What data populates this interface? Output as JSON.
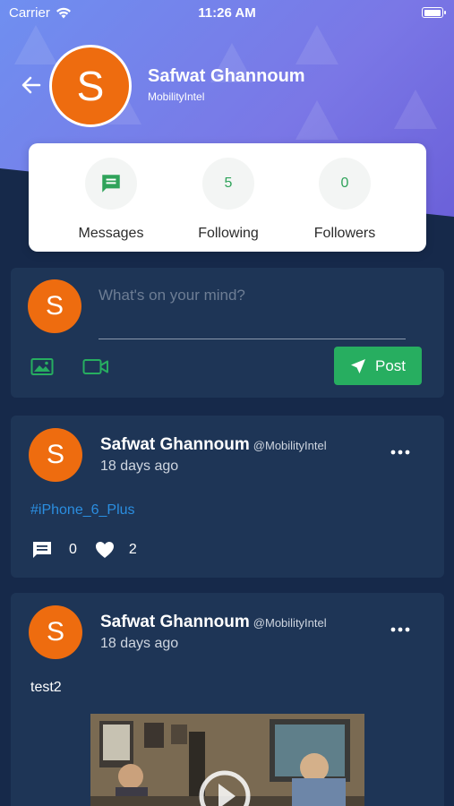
{
  "status_bar": {
    "carrier": "Carrier",
    "time": "11:26 AM"
  },
  "profile": {
    "avatar_letter": "S",
    "name": "Safwat Ghannoum",
    "handle": "MobilityIntel"
  },
  "stats": [
    {
      "label": "Messages",
      "value": "",
      "icon": "message-icon"
    },
    {
      "label": "Following",
      "value": "5"
    },
    {
      "label": "Followers",
      "value": "0"
    }
  ],
  "composer": {
    "avatar_letter": "S",
    "placeholder": "What's on your mind?",
    "post_label": "Post"
  },
  "posts": [
    {
      "avatar_letter": "S",
      "author": "Safwat Ghannoum",
      "handle": "@MobilityIntel",
      "time": "18 days ago",
      "body": "#iPhone_6_Plus",
      "comments": "0",
      "likes": "2"
    },
    {
      "avatar_letter": "S",
      "author": "Safwat Ghannoum",
      "handle": "@MobilityIntel",
      "time": "18 days ago",
      "body": "test2"
    }
  ],
  "colors": {
    "header_gradient_start": "#6f8ff0",
    "header_gradient_end": "#6a5fd8",
    "background": "#16294a",
    "card": "#1e3556",
    "avatar": "#ee6c0f",
    "accent_green": "#27ae60",
    "hashtag_blue": "#2b8ee0"
  }
}
